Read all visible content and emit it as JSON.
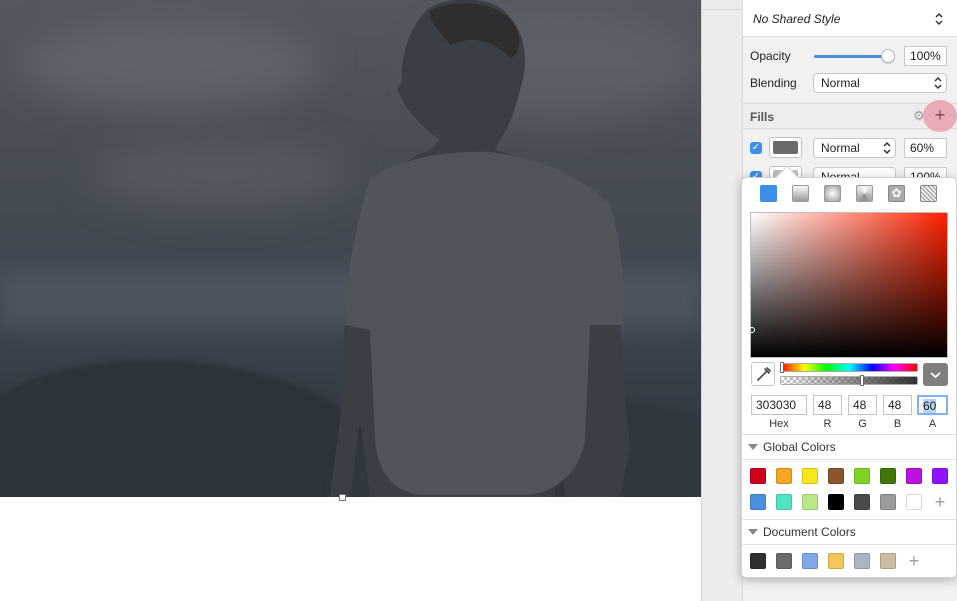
{
  "inspector": {
    "shared_style": "No Shared Style",
    "opacity_label": "Opacity",
    "opacity_value": "100%",
    "opacity_level": 1.0,
    "blending_label": "Blending",
    "blending_value": "Normal",
    "fills_title": "Fills",
    "fills": [
      {
        "enabled": true,
        "color": "#6b6b6b",
        "blend": "Normal",
        "opacity": "60%"
      },
      {
        "enabled": true,
        "color": "#bdbdbd",
        "blend": "Normal",
        "opacity": "100%"
      }
    ]
  },
  "color_picker": {
    "fill_types": [
      "solid-color",
      "linear-gradient",
      "radial-gradient",
      "angular-gradient",
      "pattern-fill",
      "noise-fill"
    ],
    "hue_position": 0.0,
    "alpha_position": 0.6,
    "hex": "303030",
    "r": "48",
    "g": "48",
    "b": "48",
    "a": "60",
    "labels": {
      "hex": "Hex",
      "r": "R",
      "g": "G",
      "b": "B",
      "a": "A"
    },
    "global_colors_title": "Global Colors",
    "global_colors": [
      "#d0021b",
      "#f5a623",
      "#f8e71c",
      "#8b572a",
      "#7ed321",
      "#417505",
      "#bd10e0",
      "#9013fe",
      "#4a90e2",
      "#50e3c2",
      "#b8e986",
      "#000000",
      "#4a4a4a",
      "#9b9b9b",
      "#ffffff"
    ],
    "document_colors_title": "Document Colors",
    "document_colors": [
      "#303030",
      "#6b6b6b",
      "#7ea8e8",
      "#f5c55a",
      "#a9b5c2",
      "#cbbca4"
    ]
  },
  "colors": {
    "accent": "#4a90e2",
    "add_highlight": "#e7a0ad"
  }
}
